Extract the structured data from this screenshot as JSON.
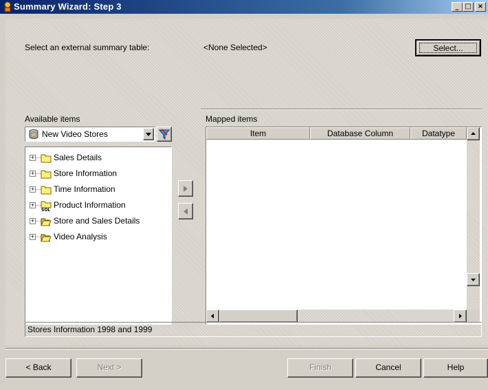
{
  "window": {
    "title": "Summary Wizard: Step 3",
    "title_icon": "wizard-icon"
  },
  "titlebar_buttons": {
    "minimize": "_",
    "maximize": "□",
    "close": "×"
  },
  "external": {
    "label": "Select an external summary table:",
    "value": "<None Selected>",
    "select_button": "Select..."
  },
  "available": {
    "label": "Available items",
    "dropdown_value": "New Video Stores",
    "tree": [
      {
        "label": "Sales Details",
        "icon": "folder-icon"
      },
      {
        "label": "Store Information",
        "icon": "folder-icon"
      },
      {
        "label": "Time Information",
        "icon": "folder-icon"
      },
      {
        "label": "Product Information",
        "icon": "sql-folder-icon"
      },
      {
        "label": "Store and Sales Details",
        "icon": "open-folder-icon"
      },
      {
        "label": "Video Analysis",
        "icon": "open-folder-icon"
      }
    ]
  },
  "mapped": {
    "label": "Mapped items",
    "columns": [
      "Item",
      "Database Column",
      "Datatype"
    ]
  },
  "status_text": "Stores Information 1998 and 1999",
  "buttons": {
    "back": "< Back",
    "next": "Next >",
    "finish": "Finish",
    "cancel": "Cancel",
    "help": "Help"
  },
  "colors": {
    "titlebar_start": "#0a246a",
    "titlebar_end": "#a6caf0",
    "face": "#d4d0c8"
  }
}
